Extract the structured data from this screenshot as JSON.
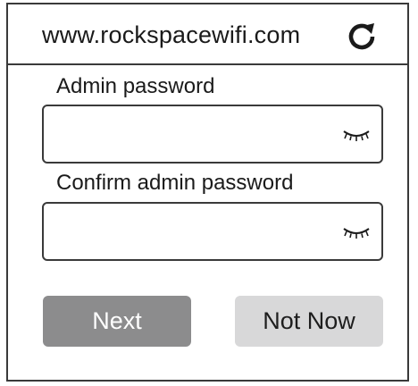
{
  "browser": {
    "url": "www.rockspacewifi.com",
    "reload_icon": "reload-icon"
  },
  "form": {
    "fields": [
      {
        "label": "Admin password",
        "value": "",
        "placeholder": "",
        "toggle_icon": "eye-closed-icon"
      },
      {
        "label": "Confirm admin password",
        "value": "",
        "placeholder": "",
        "toggle_icon": "eye-closed-icon"
      }
    ]
  },
  "actions": {
    "next_label": "Next",
    "not_now_label": "Not Now"
  },
  "colors": {
    "border": "#3a3a3a",
    "next_bg": "#8c8c8d",
    "next_text": "#ffffff",
    "not_now_bg": "#d8d8d9",
    "not_now_text": "#1e1e1e"
  }
}
